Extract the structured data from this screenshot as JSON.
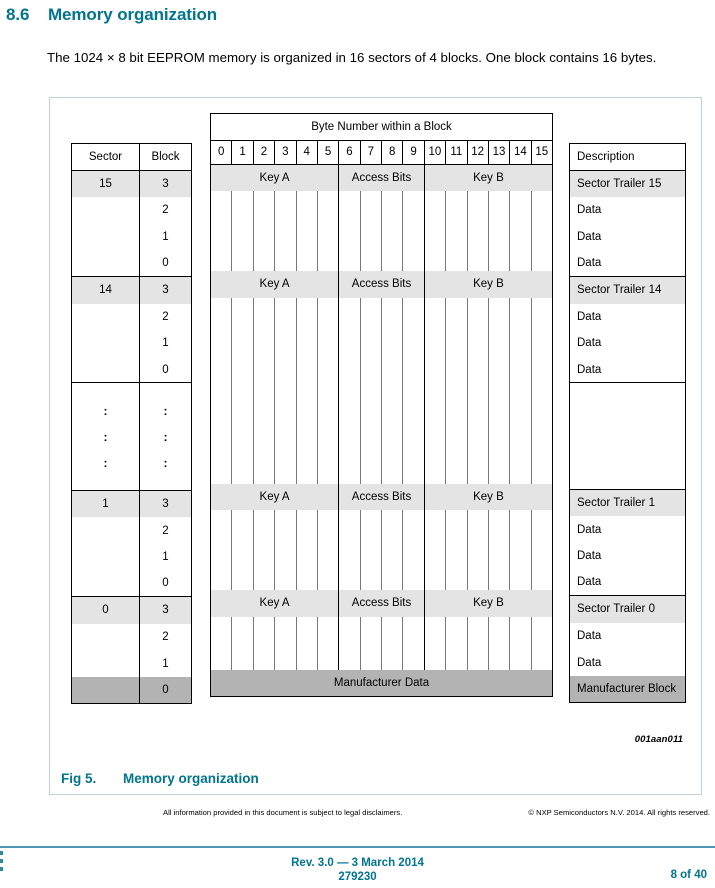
{
  "section": {
    "number": "8.6",
    "title": "Memory organization",
    "intro": "The 1024 × 8 bit EEPROM memory is organized in 16 sectors of 4 blocks. One block contains 16 bytes."
  },
  "figure": {
    "label": "Fig 5.",
    "caption": "Memory organization",
    "id": "001aan011",
    "headers": {
      "sector": "Sector",
      "block": "Block",
      "byte_title": "Byte Number within a Block",
      "description": "Description"
    },
    "byte_numbers": [
      "0",
      "1",
      "2",
      "3",
      "4",
      "5",
      "6",
      "7",
      "8",
      "9",
      "10",
      "11",
      "12",
      "13",
      "14",
      "15"
    ],
    "trailer_segments": [
      {
        "label": "Key A",
        "span": 6
      },
      {
        "label": "Access Bits",
        "span": 4
      },
      {
        "label": "Key B",
        "span": 6
      }
    ],
    "manufacturer_data_label": "Manufacturer Data",
    "manufacturer_block_label": "Manufacturer Block",
    "ellipsis_mark": ":",
    "sectors": [
      {
        "sector": "15",
        "rows": [
          {
            "block": "3",
            "type": "trailer",
            "description": "Sector Trailer 15"
          },
          {
            "block": "2",
            "type": "data",
            "description": "Data"
          },
          {
            "block": "1",
            "type": "data",
            "description": "Data"
          },
          {
            "block": "0",
            "type": "data",
            "description": "Data"
          }
        ]
      },
      {
        "sector": "14",
        "rows": [
          {
            "block": "3",
            "type": "trailer",
            "description": "Sector Trailer 14"
          },
          {
            "block": "2",
            "type": "data",
            "description": "Data"
          },
          {
            "block": "1",
            "type": "data",
            "description": "Data"
          },
          {
            "block": "0",
            "type": "data",
            "description": "Data"
          }
        ]
      },
      {
        "sector": "1",
        "rows": [
          {
            "block": "3",
            "type": "trailer",
            "description": "Sector Trailer 1"
          },
          {
            "block": "2",
            "type": "data",
            "description": "Data"
          },
          {
            "block": "1",
            "type": "data",
            "description": "Data"
          },
          {
            "block": "0",
            "type": "data",
            "description": "Data"
          }
        ]
      },
      {
        "sector": "0",
        "rows": [
          {
            "block": "3",
            "type": "trailer",
            "description": "Sector Trailer 0"
          },
          {
            "block": "2",
            "type": "data",
            "description": "Data"
          },
          {
            "block": "1",
            "type": "data",
            "description": "Data"
          },
          {
            "block": "0",
            "type": "manufacturer",
            "description": "Manufacturer Block"
          }
        ]
      }
    ],
    "colors": {
      "trailer_shade": "#e4e4e4",
      "manufacturer_shade": "#b3b3b3",
      "border": "#000000",
      "frame": "#bfd4da"
    }
  },
  "footer": {
    "legal_center": "All information provided in this document is subject to legal disclaimers.",
    "legal_right": "© NXP Semiconductors N.V. 2014. All rights reserved.",
    "revision": "Rev. 3.0 — 3 March 2014",
    "doc_number": "279230",
    "page": "8 of 40"
  },
  "theme": {
    "accent": "#00758d"
  }
}
